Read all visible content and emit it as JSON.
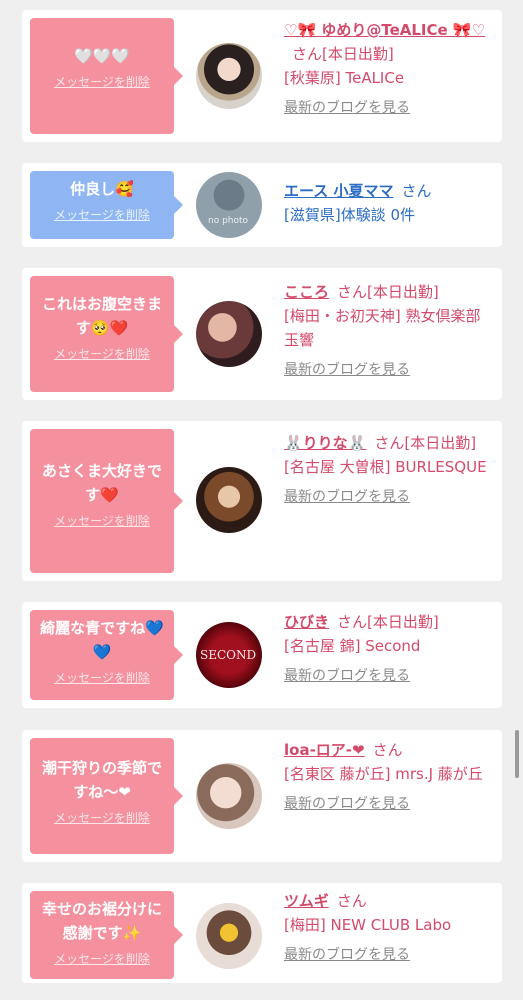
{
  "delete_label": "メッセージを削除",
  "blog_label": "最新のブログを見る",
  "cards": [
    {
      "message": "🤍🤍🤍",
      "name": "♡🎀 ゆめり@TeALICe 🎀♡",
      "san": "さん",
      "status": "[本日出勤]",
      "shop": "[秋葉原] TeALICe",
      "blog": "最新のブログを見る"
    },
    {
      "message": "仲良し🥰",
      "name": "エース 小夏ママ",
      "san": "さん",
      "shop": "[滋賀県]体験談 0件",
      "avatar_text": "no photo"
    },
    {
      "message": "これはお腹空きます🥺❤️",
      "name": "こころ",
      "san": "さん",
      "status": "[本日出勤]",
      "shop": "[梅田・お初天神] 熟女倶楽部 玉響",
      "blog": "最新のブログを見る"
    },
    {
      "message": "あさくま大好きです❤️",
      "name": "🐰りりな🐰",
      "san": "さん",
      "status": "[本日出勤]",
      "shop": "[名古屋 大曽根] BURLESQUE",
      "blog": "最新のブログを見る"
    },
    {
      "message": "綺麗な青ですね💙💙",
      "name": "ひびき",
      "san": "さん",
      "status": "[本日出勤]",
      "shop": "[名古屋 錦] Second",
      "blog": "最新のブログを見る",
      "avatar_text": "SECOND"
    },
    {
      "message": "潮干狩りの季節ですね〜❤",
      "name": "loa-ロア-❤",
      "san": "さん",
      "shop": "[名東区 藤が丘] mrs.J 藤が丘",
      "blog": "最新のブログを見る"
    },
    {
      "message": "幸せのお裾分けに感謝です✨",
      "name": "ツムギ",
      "san": "さん",
      "shop": "[梅田] NEW CLUB Labo",
      "blog": "最新のブログを見る"
    }
  ],
  "colors": {
    "pink_bubble": "#f5909e",
    "blue_bubble": "#8fb6f2",
    "pink_text": "#d44a6b",
    "blue_text": "#2b6cc4",
    "blog_link": "#8a8a8a"
  }
}
